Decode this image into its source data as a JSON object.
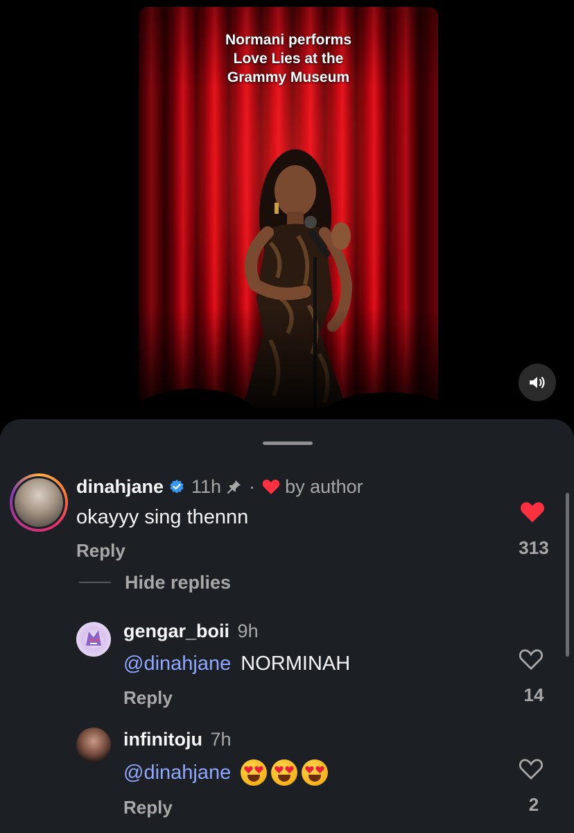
{
  "video": {
    "caption_lines": [
      "Normani performs",
      "Love Lies at the",
      "Grammy Museum"
    ],
    "sound_icon": "speaker-icon"
  },
  "colors": {
    "sheet_bg": "#1c1f24",
    "mention": "#8ea8ff",
    "heart_red": "#ff3040",
    "verified_blue": "#3797f0",
    "muted_text": "#a8a8a8"
  },
  "comments": [
    {
      "username": "dinahjane",
      "verified": true,
      "time": "11h",
      "pinned": true,
      "separator": "·",
      "liked_by_author_label": "by author",
      "text": "okayyy sing thennn",
      "reply_label": "Reply",
      "liked": true,
      "like_count": "313",
      "toggle_replies_label": "Hide replies",
      "replies": [
        {
          "username": "gengar_boii",
          "time": "9h",
          "mention": "@dinahjane",
          "text": "NORMINAH",
          "reply_label": "Reply",
          "liked": false,
          "like_count": "14"
        },
        {
          "username": "infinitoju",
          "time": "7h",
          "mention": "@dinahjane",
          "text": "",
          "emojis": [
            "smiling-face-with-heart-eyes",
            "smiling-face-with-heart-eyes",
            "smiling-face-with-heart-eyes"
          ],
          "reply_label": "Reply",
          "liked": false,
          "like_count": "2"
        }
      ]
    }
  ]
}
